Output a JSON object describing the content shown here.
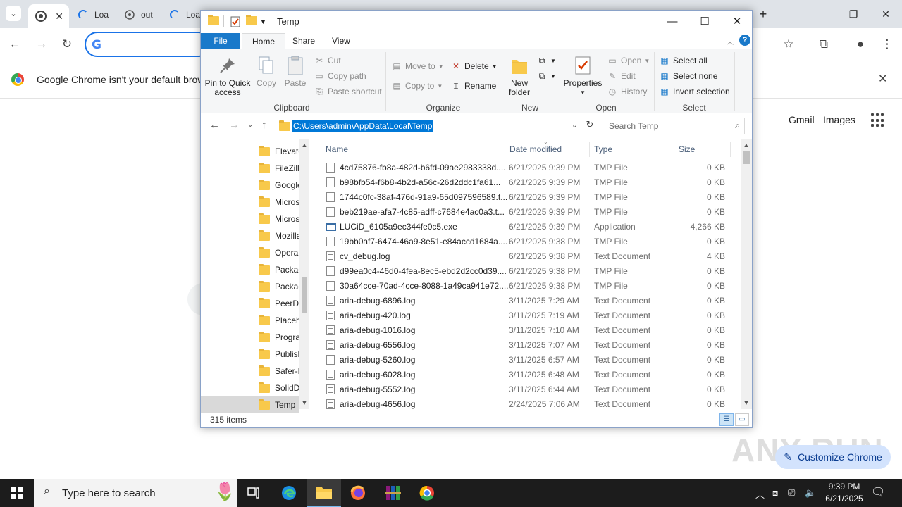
{
  "chrome": {
    "tabs": [
      {
        "label": "Loa",
        "state": "loading"
      },
      {
        "label": "out",
        "state": "loaded"
      },
      {
        "label": "Loa",
        "state": "loading"
      }
    ],
    "new_tab_icon": "plus-icon",
    "infobar_text": "Google Chrome isn't your default browser",
    "ntp_links": {
      "gmail": "Gmail",
      "images": "Images"
    },
    "customize_label": "Customize Chrome"
  },
  "watermark": "ANY RUN",
  "explorer": {
    "title": "Temp",
    "ribbon_tabs": [
      "File",
      "Home",
      "Share",
      "View"
    ],
    "clipboard": {
      "pin": "Pin to Quick access",
      "copy": "Copy",
      "paste": "Paste",
      "cut": "Cut",
      "copy_path": "Copy path",
      "paste_shortcut": "Paste shortcut",
      "label": "Clipboard"
    },
    "organize": {
      "move_to": "Move to",
      "copy_to": "Copy to",
      "delete": "Delete",
      "rename": "Rename",
      "label": "Organize"
    },
    "new": {
      "new_folder": "New folder",
      "label": "New"
    },
    "open": {
      "properties": "Properties",
      "open": "Open",
      "edit": "Edit",
      "history": "History",
      "label": "Open"
    },
    "select": {
      "select_all": "Select all",
      "select_none": "Select none",
      "invert": "Invert selection",
      "label": "Select"
    },
    "address": "C:\\Users\\admin\\AppData\\Local\\Temp",
    "search_placeholder": "Search Temp",
    "nav_items": [
      "Elevate",
      "FileZilla",
      "Google",
      "Microso",
      "Microso",
      "Mozilla",
      "Opera",
      "Packag",
      "Packag",
      "PeerDis",
      "Placeho",
      "Program",
      "Publish",
      "Safer-N",
      "SolidDo",
      "Temp"
    ],
    "columns": {
      "name": "Name",
      "date": "Date modified",
      "type": "Type",
      "size": "Size"
    },
    "files": [
      {
        "name": "4cd75876-fb8a-482d-b6fd-09ae2983338d....",
        "date": "6/21/2025 9:39 PM",
        "type": "TMP File",
        "size": "0 KB",
        "icon": "blank-file-icon"
      },
      {
        "name": "b98bfb54-f6b8-4b2d-a56c-26d2ddc1fa61...",
        "date": "6/21/2025 9:39 PM",
        "type": "TMP File",
        "size": "0 KB",
        "icon": "blank-file-icon"
      },
      {
        "name": "1744c0fc-38af-476d-91a9-65d097596589.t...",
        "date": "6/21/2025 9:39 PM",
        "type": "TMP File",
        "size": "0 KB",
        "icon": "blank-file-icon"
      },
      {
        "name": "beb219ae-afa7-4c85-adff-c7684e4ac0a3.t...",
        "date": "6/21/2025 9:39 PM",
        "type": "TMP File",
        "size": "0 KB",
        "icon": "blank-file-icon"
      },
      {
        "name": "LUCiD_6105a9ec344fe0c5.exe",
        "date": "6/21/2025 9:39 PM",
        "type": "Application",
        "size": "4,266 KB",
        "icon": "exe-icon"
      },
      {
        "name": "19bb0af7-6474-46a9-8e51-e84accd1684a....",
        "date": "6/21/2025 9:38 PM",
        "type": "TMP File",
        "size": "0 KB",
        "icon": "blank-file-icon"
      },
      {
        "name": "cv_debug.log",
        "date": "6/21/2025 9:38 PM",
        "type": "Text Document",
        "size": "4 KB",
        "icon": "text-file-icon"
      },
      {
        "name": "d99ea0c4-46d0-4fea-8ec5-ebd2d2cc0d39....",
        "date": "6/21/2025 9:38 PM",
        "type": "TMP File",
        "size": "0 KB",
        "icon": "blank-file-icon"
      },
      {
        "name": "30a64cce-70ad-4cce-8088-1a49ca941e72....",
        "date": "6/21/2025 9:38 PM",
        "type": "TMP File",
        "size": "0 KB",
        "icon": "blank-file-icon"
      },
      {
        "name": "aria-debug-6896.log",
        "date": "3/11/2025 7:29 AM",
        "type": "Text Document",
        "size": "0 KB",
        "icon": "text-file-icon"
      },
      {
        "name": "aria-debug-420.log",
        "date": "3/11/2025 7:19 AM",
        "type": "Text Document",
        "size": "0 KB",
        "icon": "text-file-icon"
      },
      {
        "name": "aria-debug-1016.log",
        "date": "3/11/2025 7:10 AM",
        "type": "Text Document",
        "size": "0 KB",
        "icon": "text-file-icon"
      },
      {
        "name": "aria-debug-6556.log",
        "date": "3/11/2025 7:07 AM",
        "type": "Text Document",
        "size": "0 KB",
        "icon": "text-file-icon"
      },
      {
        "name": "aria-debug-5260.log",
        "date": "3/11/2025 6:57 AM",
        "type": "Text Document",
        "size": "0 KB",
        "icon": "text-file-icon"
      },
      {
        "name": "aria-debug-6028.log",
        "date": "3/11/2025 6:48 AM",
        "type": "Text Document",
        "size": "0 KB",
        "icon": "text-file-icon"
      },
      {
        "name": "aria-debug-5552.log",
        "date": "3/11/2025 6:44 AM",
        "type": "Text Document",
        "size": "0 KB",
        "icon": "text-file-icon"
      },
      {
        "name": "aria-debug-4656.log",
        "date": "2/24/2025 7:06 AM",
        "type": "Text Document",
        "size": "0 KB",
        "icon": "text-file-icon"
      }
    ],
    "status": "315 items"
  },
  "taskbar": {
    "search_placeholder": "Type here to search",
    "apps": [
      "task-view-icon",
      "edge-icon",
      "file-explorer-icon",
      "firefox-icon",
      "winrar-icon",
      "chrome-icon"
    ],
    "time": "9:39 PM",
    "date": "6/21/2025"
  },
  "colors": {
    "accent": "#1979ca",
    "selection": "#0078d7",
    "taskbar": "#1c1c1c",
    "chrome_frame": "#dfe3e8"
  }
}
